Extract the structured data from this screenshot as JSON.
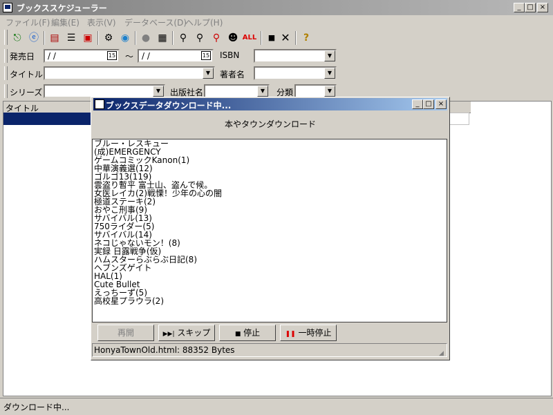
{
  "window": {
    "title": "ブックススケジューラー"
  },
  "menu": [
    {
      "label": "ファイル(F)"
    },
    {
      "label": "編集(E)"
    },
    {
      "label": "表示(V)"
    },
    {
      "label": "データベース(D)"
    },
    {
      "label": "ヘルプ(H)"
    }
  ],
  "toolbar": {
    "icons": [
      "exit-icon",
      "ie-icon",
      "book-icon",
      "list-icon",
      "book-red-icon",
      "settings-icon",
      "globe-icon",
      "stop-circle-icon",
      "document-icon",
      "search-icon",
      "search-plus-icon",
      "search-red-icon",
      "person-icon",
      "all-icon",
      "square-icon",
      "close-icon",
      "help-icon"
    ],
    "all_label": "ALL"
  },
  "filters": {
    "release_date_label": "発売日",
    "date_from": "/ /",
    "range_sep": "～",
    "date_to": "/ /",
    "isbn_label": "ISBN",
    "title_label": "タイトル",
    "author_label": "著者名",
    "series_label": "シリーズ",
    "publisher_label": "出版社名",
    "category_label": "分類",
    "calendar_glyph": "15"
  },
  "table": {
    "columns": [
      "タイトル"
    ]
  },
  "status": {
    "text": "ダウンロード中..."
  },
  "dialog": {
    "title": "ブックスデータダウンロード中...",
    "heading": "本やタウンダウンロード",
    "items": [
      "ブルー・レスキュー",
      "(成)EMERGENCY",
      "ゲームコミックKanon(1)",
      "中華演義選(12)",
      "ゴルゴ13(119)",
      "雲盗り暫平  富士山、盗んで候。",
      "女医レイカ(2)戦慄！少年の心の闇",
      "極道ステーキ(2)",
      "おやこ刑事(9)",
      "サバイバル(13)",
      "750ライダー(5)",
      "サバイバル(14)",
      "ネコじゃないモン！(8)",
      "実録  日露戦争(仮)",
      "ハムスターらぶらぶ日記(8)",
      "ヘブンズゲイト",
      "HAL(1)",
      "Cute Bullet",
      "えっちーず(5)",
      "高校星プラウラ(2)"
    ],
    "buttons": {
      "resume": "再開",
      "skip": "スキップ",
      "stop": "停止",
      "pause": "一時停止"
    },
    "status": "HonyaTownOld.html: 88352 Bytes"
  }
}
